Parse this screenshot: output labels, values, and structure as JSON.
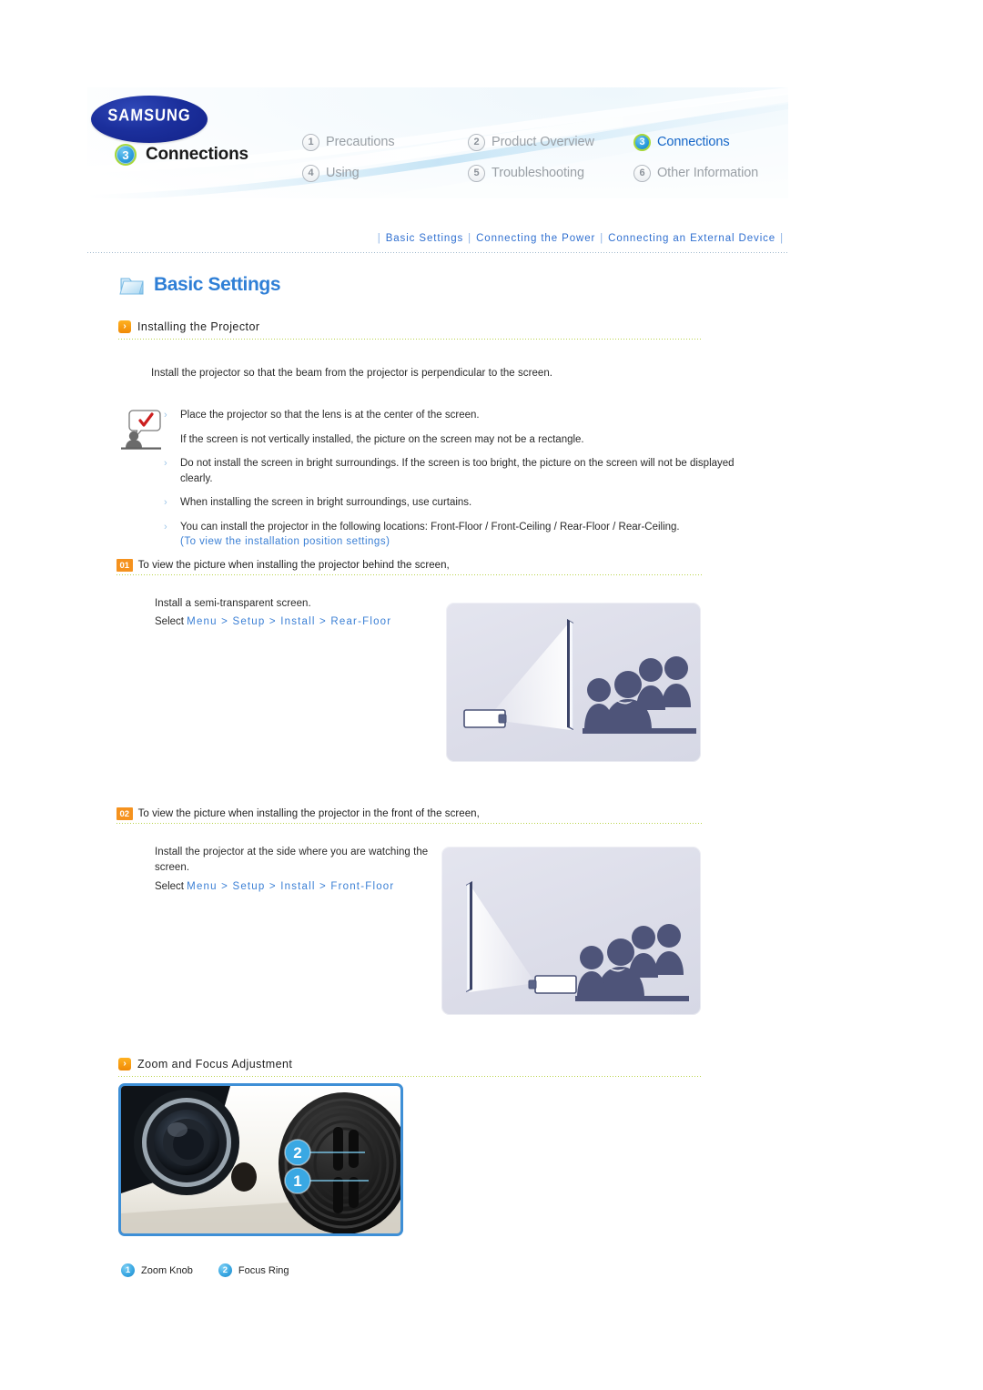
{
  "header": {
    "brand": "SAMSUNG",
    "current_section_number": "3",
    "current_section_label": "Connections",
    "nav": [
      {
        "number": "1",
        "label": "Precautions",
        "active": false
      },
      {
        "number": "2",
        "label": "Product Overview",
        "active": false
      },
      {
        "number": "3",
        "label": "Connections",
        "active": true
      },
      {
        "number": "4",
        "label": "Using",
        "active": false
      },
      {
        "number": "5",
        "label": "Troubleshooting",
        "active": false
      },
      {
        "number": "6",
        "label": "Other Information",
        "active": false
      }
    ]
  },
  "toplinks": {
    "items": [
      "Basic Settings",
      "Connecting the Power",
      "Connecting an External Device"
    ],
    "separator": "|"
  },
  "page_title": "Basic Settings",
  "sections": {
    "installing": {
      "heading": "Installing the Projector",
      "intro": "Install the projector so that the beam from the projector is perpendicular to the screen.",
      "notes": [
        "Place the projector so that the lens is at the center of the screen.",
        "If the screen is not vertically installed, the picture on the screen may not be a rectangle.",
        "Do not install the screen in bright surroundings. If the screen is too bright, the picture on the screen will not be displayed clearly.",
        "When installing the screen in bright surroundings, use curtains.",
        "You can install the projector in the following locations: Front-Floor / Front-Ceiling / Rear-Floor / Rear-Ceiling."
      ],
      "note_link_prefix": "(",
      "note_link": "To view the installation position settings",
      "note_link_suffix": ")"
    },
    "step01": {
      "badge": "01",
      "title": "To view the picture when installing the projector behind the screen,",
      "line1": "Install a semi-transparent screen.",
      "select_prefix": "Select ",
      "select_path": "Menu > Setup > Install > Rear-Floor",
      "illustration": "rear-floor-projection-diagram"
    },
    "step02": {
      "badge": "02",
      "title": "To view the picture when installing the projector in the front of the screen,",
      "line1": "Install the projector at the side where you are watching the screen.",
      "select_prefix": "Select ",
      "select_path": "Menu > Setup > Install > Front-Floor",
      "illustration": "front-floor-projection-diagram"
    },
    "zoom_focus": {
      "heading": "Zoom and Focus Adjustment",
      "photo": "projector-lens-and-focus-ring-photo",
      "callouts": [
        {
          "number": "1",
          "label": "Zoom Knob"
        },
        {
          "number": "2",
          "label": "Focus Ring"
        }
      ]
    }
  },
  "colors": {
    "link_blue": "#2f6fd0",
    "title_blue": "#2f7fd6",
    "badge_orange": "#f5921e",
    "rule_green": "#b9d44a",
    "active_nav": "#1566c8",
    "photo_border": "#3e8fd6",
    "samsung_navy": "#1b2f9c"
  }
}
